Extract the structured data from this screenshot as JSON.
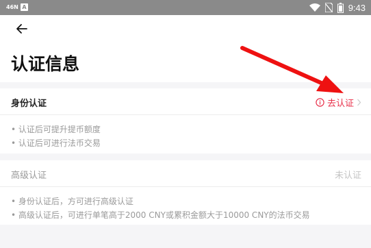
{
  "status_bar": {
    "left_text": "46N",
    "app_badge": "A",
    "time": "9:43"
  },
  "page": {
    "title": "认证信息"
  },
  "identity": {
    "label": "身份认证",
    "action": "去认证",
    "bullets": [
      "认证后可提升提币额度",
      "认证后可进行法币交易"
    ]
  },
  "advanced": {
    "label": "高级认证",
    "status": "未认证",
    "bullets": [
      "身份认证后，方可进行高级认证",
      "高级认证后，可进行单笔高于2000 CNY或累积金额大于10000 CNY的法币交易"
    ]
  },
  "colors": {
    "accent_red": "#e8304a",
    "annotation_red": "#ee1111",
    "muted": "#9a9a9a",
    "status_bar": "#8a8a8a"
  }
}
